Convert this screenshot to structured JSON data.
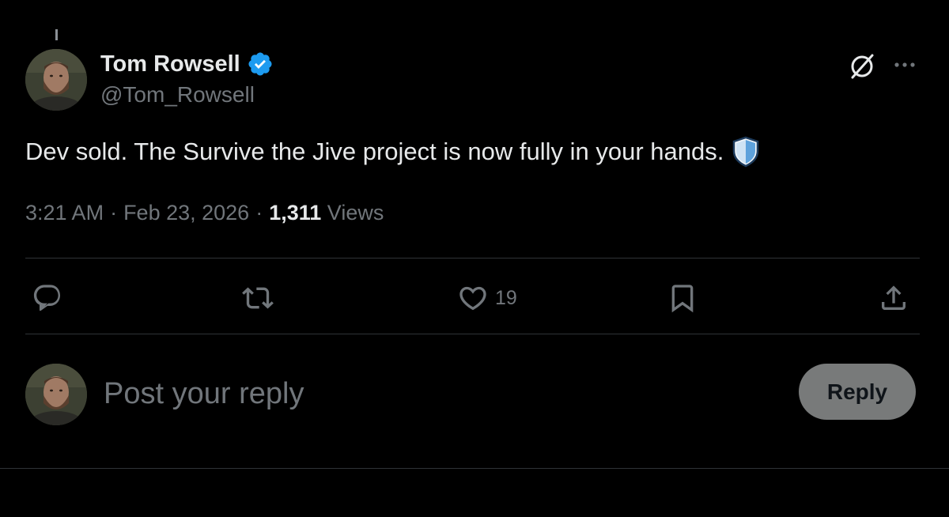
{
  "post": {
    "author_name": "Tom Rowsell",
    "author_handle": "@Tom_Rowsell",
    "verified": true,
    "text": "Dev sold. The Survive the Jive project is now fully in your hands.",
    "emoji_icon": "shield-icon",
    "time": "3:21 AM",
    "date": "Feb 23, 2026",
    "separator": "·",
    "views_count": "1,311",
    "views_label": "Views"
  },
  "header_actions": {
    "grok_icon": "grok-icon",
    "more_icon": "more-horizontal-icon"
  },
  "actions": {
    "reply_icon": "reply-icon",
    "repost_icon": "repost-icon",
    "like_icon": "heart-icon",
    "like_count": "19",
    "bookmark_icon": "bookmark-icon",
    "share_icon": "share-icon"
  },
  "reply_box": {
    "placeholder": "Post your reply",
    "button_label": "Reply"
  },
  "colors": {
    "background": "#000000",
    "text_primary": "#e7e9ea",
    "text_secondary": "#71767b",
    "divider": "#2f3336",
    "verified_blue": "#1d9bf0",
    "reply_button_bg": "#787a7a"
  }
}
